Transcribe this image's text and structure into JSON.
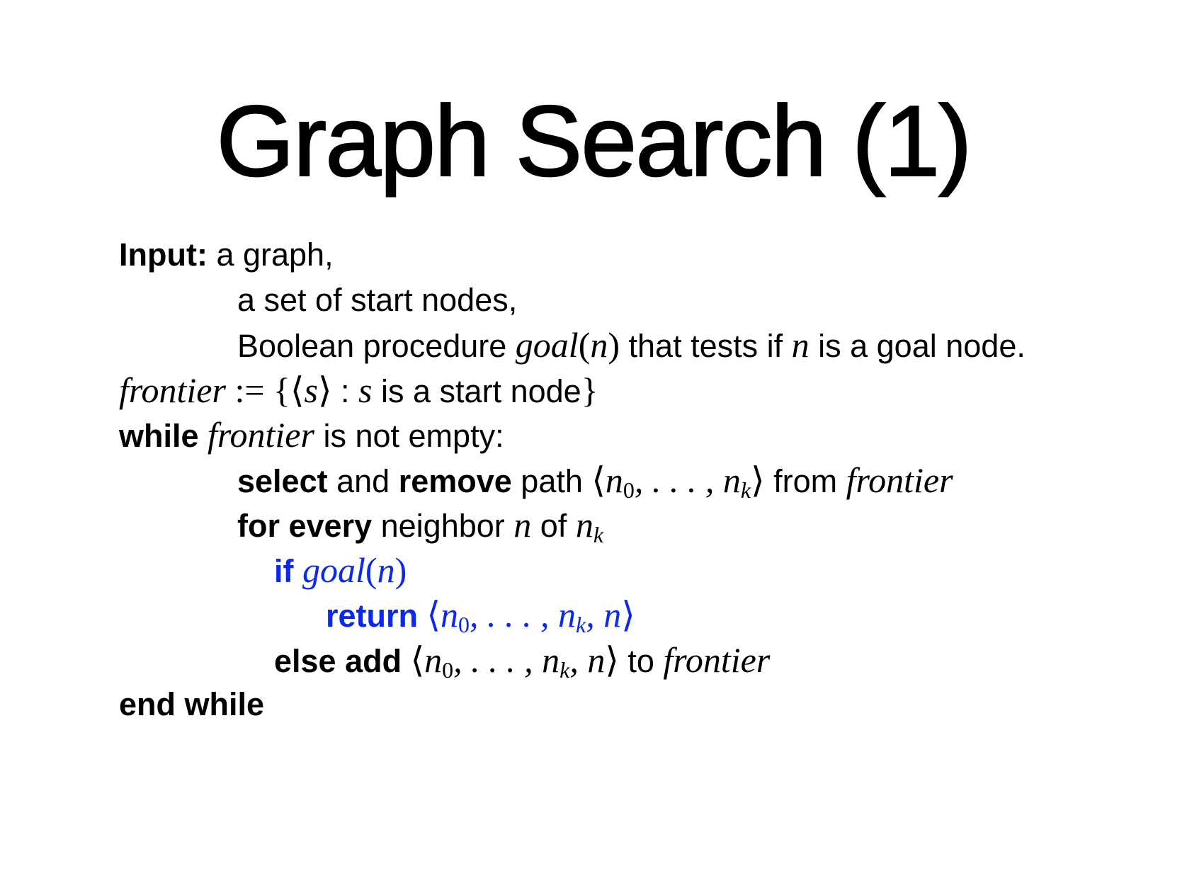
{
  "title": "Graph Search (1)",
  "accent_color": "#0a28f0",
  "lines": [
    {
      "name": "input-line-1",
      "indent": 0,
      "segs": [
        {
          "c": "b",
          "t": "Input: "
        },
        {
          "t": "a graph,"
        }
      ]
    },
    {
      "name": "input-line-2",
      "indent": 1,
      "segs": [
        {
          "t": "a set of start nodes,"
        }
      ]
    },
    {
      "name": "input-line-3",
      "indent": 1,
      "segs": [
        {
          "t": "Boolean procedure "
        },
        {
          "c": "m",
          "t": "goal"
        },
        {
          "c": "r",
          "t": "("
        },
        {
          "c": "m",
          "t": "n"
        },
        {
          "c": "r",
          "t": ")"
        },
        {
          "t": " that tests if "
        },
        {
          "c": "m",
          "t": "n"
        },
        {
          "t": " is a goal node."
        }
      ]
    },
    {
      "name": "frontier-init-line",
      "indent": 0,
      "segs": [
        {
          "c": "m",
          "t": "frontier"
        },
        {
          "c": "r",
          "t": " := {⟨"
        },
        {
          "c": "m",
          "t": "s"
        },
        {
          "c": "r",
          "t": "⟩"
        },
        {
          "t": " : "
        },
        {
          "c": "m",
          "t": "s"
        },
        {
          "t": " is a start node"
        },
        {
          "c": "r",
          "t": "}"
        }
      ]
    },
    {
      "name": "while-line",
      "indent": 0,
      "segs": [
        {
          "c": "b",
          "t": "while "
        },
        {
          "c": "m",
          "t": "frontier"
        },
        {
          "t": " is not empty:"
        }
      ]
    },
    {
      "name": "select-line",
      "indent": 1,
      "segs": [
        {
          "c": "b",
          "t": "select"
        },
        {
          "t": " and "
        },
        {
          "c": "b",
          "t": "remove"
        },
        {
          "t": " path "
        },
        {
          "c": "r",
          "t": "⟨"
        },
        {
          "c": "m",
          "t": "n",
          "sub": "0"
        },
        {
          "c": "m",
          "t": ", . . . , "
        },
        {
          "c": "m",
          "t": "n",
          "sub": "k"
        },
        {
          "c": "r",
          "t": "⟩"
        },
        {
          "t": " from "
        },
        {
          "c": "m",
          "t": "frontier"
        }
      ]
    },
    {
      "name": "for-every-line",
      "indent": 1,
      "segs": [
        {
          "c": "b",
          "t": "for every"
        },
        {
          "t": " neighbor "
        },
        {
          "c": "m",
          "t": "n"
        },
        {
          "t": " of "
        },
        {
          "c": "m",
          "t": "n",
          "sub": "k"
        }
      ]
    },
    {
      "name": "if-goal-line",
      "indent": 2,
      "blue": true,
      "segs": [
        {
          "c": "b",
          "t": "if "
        },
        {
          "c": "m",
          "t": "goal"
        },
        {
          "c": "r",
          "t": "("
        },
        {
          "c": "m",
          "t": "n"
        },
        {
          "c": "r",
          "t": ")"
        }
      ]
    },
    {
      "name": "return-line",
      "indent": 3,
      "blue": true,
      "segs": [
        {
          "c": "b",
          "t": "return "
        },
        {
          "c": "r",
          "t": "⟨"
        },
        {
          "c": "m",
          "t": "n",
          "sub": "0"
        },
        {
          "c": "m",
          "t": ", . . . , "
        },
        {
          "c": "m",
          "t": "n",
          "sub": "k"
        },
        {
          "c": "m",
          "t": ", n"
        },
        {
          "c": "r",
          "t": "⟩"
        }
      ]
    },
    {
      "name": "else-add-line",
      "indent": 2,
      "segs": [
        {
          "c": "b",
          "t": "else add "
        },
        {
          "c": "r",
          "t": "⟨"
        },
        {
          "c": "m",
          "t": "n",
          "sub": "0"
        },
        {
          "c": "m",
          "t": ", . . . , "
        },
        {
          "c": "m",
          "t": "n",
          "sub": "k"
        },
        {
          "c": "m",
          "t": ", n"
        },
        {
          "c": "r",
          "t": "⟩"
        },
        {
          "t": " to "
        },
        {
          "c": "m",
          "t": "frontier"
        }
      ]
    },
    {
      "name": "end-while-line",
      "indent": 0,
      "segs": [
        {
          "c": "b",
          "t": "end while"
        }
      ]
    }
  ]
}
